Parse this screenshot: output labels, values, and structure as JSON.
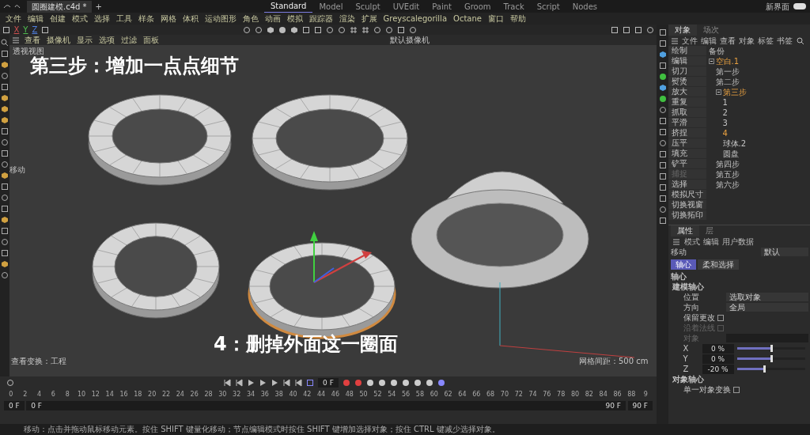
{
  "title_bar": {
    "file_tab": "圆圈建模.c4d *",
    "layouts": [
      {
        "label": "Standard",
        "selected": true
      },
      {
        "label": "Model",
        "selected": false
      },
      {
        "label": "Sculpt",
        "selected": false
      },
      {
        "label": "UVEdit",
        "selected": false
      },
      {
        "label": "Paint",
        "selected": false
      },
      {
        "label": "Groom",
        "selected": false
      },
      {
        "label": "Track",
        "selected": false
      },
      {
        "label": "Script",
        "selected": false
      },
      {
        "label": "Nodes",
        "selected": false
      }
    ],
    "add_tab": "+",
    "new_ui_label": "新界面",
    "new_ui_on": true
  },
  "menu_bar": [
    "文件",
    "编辑",
    "创建",
    "模式",
    "选择",
    "工具",
    "样条",
    "网格",
    "体积",
    "运动图形",
    "角色",
    "动画",
    "模拟",
    "跟踪器",
    "渲染",
    "扩展",
    "Greyscalegorilla",
    "Octane",
    "窗口",
    "帮助"
  ],
  "toolbar": {
    "axes": [
      "X",
      "Y",
      "Z"
    ]
  },
  "viewport": {
    "menu": [
      "查看",
      "摄像机",
      "显示",
      "选项",
      "过滤",
      "面板"
    ],
    "view_name": "透视视图",
    "camera": "默认摄像机",
    "tool_label": "移动",
    "caption_top": "第三步：增加一点点细节",
    "caption_bottom": "4：删掉外面这一圈面",
    "status_left": "查看变换：工程",
    "status_right": "网格间距：500 cm"
  },
  "objects_panel": {
    "tabs": [
      {
        "label": "对象",
        "selected": true
      },
      {
        "label": "场次",
        "selected": false
      }
    ],
    "menu": [
      "文件",
      "编辑",
      "查看",
      "对象",
      "标签",
      "书签"
    ],
    "tools": [
      {
        "label": "绘制",
        "disabled": false
      },
      {
        "label": "编辑",
        "disabled": false
      },
      {
        "label": "切刀",
        "disabled": false
      },
      {
        "label": "熨烫",
        "disabled": false
      },
      {
        "label": "放大",
        "disabled": false
      },
      {
        "label": "重复",
        "disabled": false
      },
      {
        "label": "抓取",
        "disabled": false
      },
      {
        "label": "平滑",
        "disabled": false
      },
      {
        "label": "挤捏",
        "disabled": false
      },
      {
        "label": "压平",
        "disabled": false
      },
      {
        "label": "填充",
        "disabled": false
      },
      {
        "label": "铲平",
        "disabled": false
      },
      {
        "label": "捕捉",
        "disabled": true
      },
      {
        "label": "选择",
        "disabled": false
      },
      {
        "label": "模拟尺寸",
        "disabled": false
      },
      {
        "label": "切换视窗",
        "disabled": false
      },
      {
        "label": "切换拓印",
        "disabled": false
      }
    ],
    "tree": [
      {
        "label": "备份",
        "selected": false
      },
      {
        "label": "空白.1",
        "selected": true,
        "expanded": true,
        "children": [
          {
            "label": "第一步",
            "selected": false
          },
          {
            "label": "第二步",
            "selected": false
          },
          {
            "label": "第三步",
            "selected": true,
            "expanded": true,
            "children": [
              {
                "label": "1",
                "selected": false
              },
              {
                "label": "2",
                "selected": false
              },
              {
                "label": "3",
                "selected": false
              },
              {
                "label": "4",
                "selected": true
              },
              {
                "label": "球体.2",
                "selected": false
              },
              {
                "label": "圆盘",
                "selected": false
              }
            ]
          },
          {
            "label": "第四步",
            "selected": false
          },
          {
            "label": "第五步",
            "selected": false
          },
          {
            "label": "第六步",
            "selected": false
          }
        ]
      }
    ]
  },
  "attributes": {
    "tabs": [
      {
        "label": "属性",
        "selected": true
      },
      {
        "label": "层",
        "selected": false
      }
    ],
    "menu": [
      "模式",
      "编辑",
      "用户数据"
    ],
    "tool": "移动",
    "preset": "默认",
    "subtabs": [
      {
        "label": "轴心",
        "selected": true
      },
      {
        "label": "柔和选择",
        "selected": false
      }
    ],
    "heading": "轴心",
    "groups": [
      {
        "title": "建模轴心",
        "rows": [
          {
            "kind": "dropdown",
            "label": "位置",
            "value": "选取对象",
            "disabled": false
          },
          {
            "kind": "dropdown",
            "label": "方向",
            "value": "全局",
            "disabled": false
          },
          {
            "kind": "checkbox",
            "label": "保留更改",
            "checked": false,
            "disabled": false
          },
          {
            "kind": "checkbox",
            "label": "沿着法线",
            "checked": false,
            "disabled": true
          },
          {
            "kind": "dropdown",
            "label": "对象",
            "disabled": true
          },
          {
            "kind": "slider",
            "label": "X",
            "value": "0 %",
            "level": 0.5
          },
          {
            "kind": "slider",
            "label": "Y",
            "value": "0 %",
            "level": 0.5
          },
          {
            "kind": "slider",
            "label": "Z",
            "value": "-20 %",
            "level": 0.4
          }
        ]
      },
      {
        "title": "对象轴心",
        "rows": [
          {
            "kind": "checkbox",
            "label": "单一对象变换",
            "checked": false,
            "disabled": false
          }
        ]
      }
    ]
  },
  "timeline": {
    "current": "0 F",
    "ticks": [
      "0",
      "2",
      "4",
      "6",
      "8",
      "10",
      "12",
      "14",
      "16",
      "18",
      "20",
      "22",
      "24",
      "26",
      "28",
      "30",
      "32",
      "34",
      "36",
      "38",
      "40",
      "42",
      "44",
      "46",
      "48",
      "50",
      "52",
      "54",
      "56",
      "58",
      "60",
      "62",
      "64",
      "66",
      "68",
      "70",
      "72",
      "74",
      "76",
      "78",
      "80",
      "82",
      "84",
      "86",
      "88",
      "9"
    ],
    "range_start": "0 F",
    "range_min": "0 F",
    "range_max": "90 F",
    "range_end": "90 F"
  },
  "status_bar": "移动：点击并拖动鼠标移动元素。按住 SHIFT 键量化移动；节点编辑模式时按住 SHIFT 键增加选择对象；按住 CTRL 键减少选择对象。"
}
